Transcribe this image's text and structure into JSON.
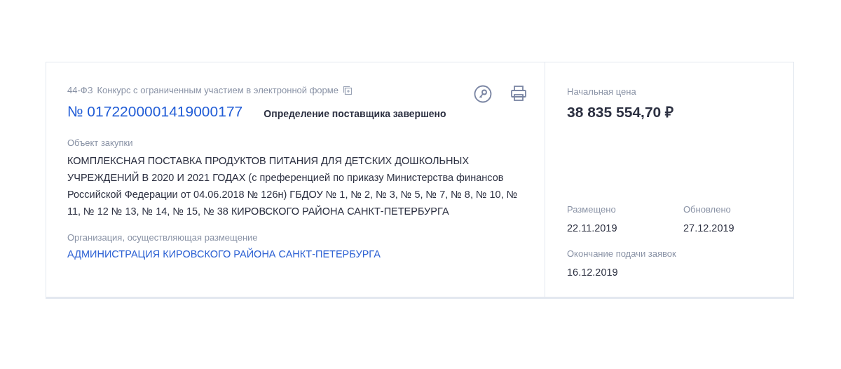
{
  "procurement": {
    "law": "44-ФЗ",
    "method": "Конкурс с ограниченным участием в электронной форме",
    "number": "№ 0172200001419000177",
    "status": "Определение поставщика завершено",
    "object_label": "Объект закупки",
    "object": "КОМПЛЕКСНАЯ ПОСТАВКА ПРОДУКТОВ ПИТАНИЯ ДЛЯ ДЕТСКИХ ДОШКОЛЬНЫХ УЧРЕЖДЕНИЙ В 2020 И 2021 ГОДАХ (с преференцией по приказу Министерства финансов Российской Федерации от 04.06.2018 № 126н) ГБДОУ № 1, № 2, № 3, № 5, № 7, № 8, № 10, № 11, № 12 № 13, № 14, № 15, № 38 КИРОВСКОГО РАЙОНА САНКТ-ПЕТЕРБУРГА",
    "org_label": "Организация, осуществляющая размещение",
    "org": "АДМИНИСТРАЦИЯ КИРОВСКОГО РАЙОНА САНКТ-ПЕТЕРБУРГА"
  },
  "price": {
    "label": "Начальная цена",
    "value": "38 835 554,70 ₽"
  },
  "dates": [
    {
      "label": "Размещено",
      "value": "22.11.2019"
    },
    {
      "label": "Обновлено",
      "value": "27.12.2019"
    },
    {
      "label": "Окончание подачи заявок",
      "value": "16.12.2019"
    }
  ]
}
